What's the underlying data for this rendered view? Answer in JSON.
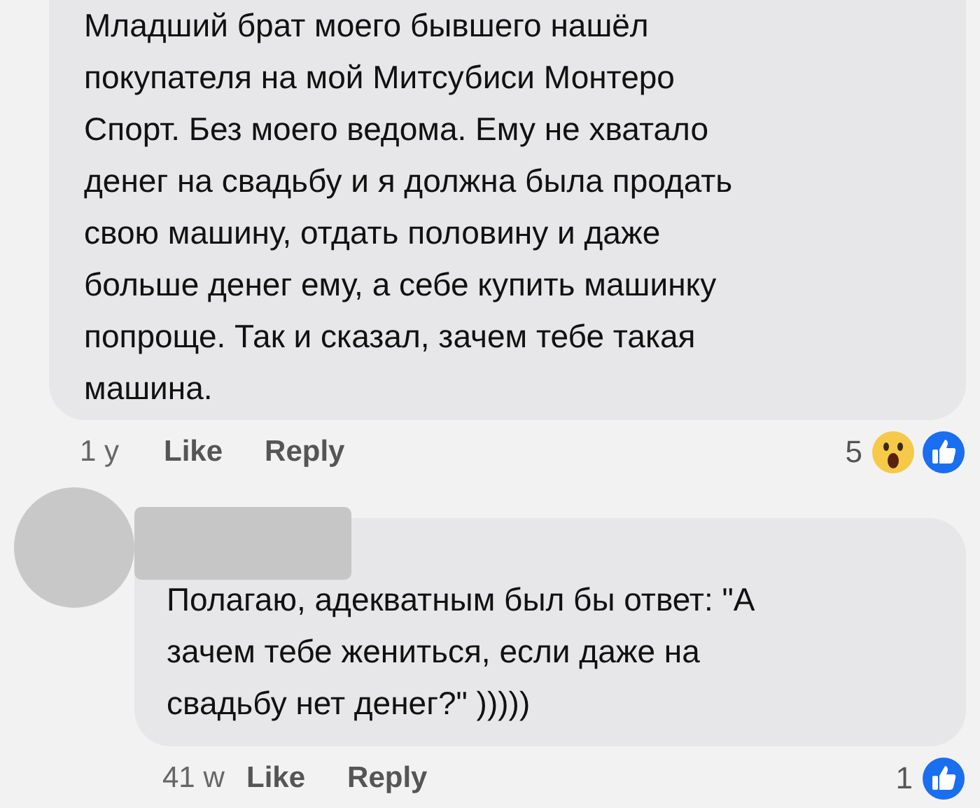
{
  "comments": [
    {
      "text_lines": [
        "Младший брат моего бывшего нашёл",
        "покупателя на мой Митсубиси Монтеро",
        "Спорт. Без моего ведома. Ему не хватало",
        "денег на свадьбу и я должна была продать",
        "свою машину, отдать половину и даже",
        "больше денег ему, а себе купить машинку",
        "попроще. Так и сказал, зачем тебе такая",
        "машина."
      ],
      "time": "1 y",
      "actions": [
        "Like",
        "Reply"
      ],
      "reaction_count": "5",
      "reactions": [
        {
          "kind": "wow"
        },
        {
          "kind": "like"
        }
      ]
    },
    {
      "author_redacted": true,
      "text_lines": [
        "Полагаю, адекватным был бы ответ: \"А",
        "зачем тебе жениться, если даже на",
        "свадьбу нет денег?\" )))))"
      ],
      "time": "41 w",
      "actions": [
        "Like",
        "Reply"
      ],
      "reaction_count": "1",
      "reactions": [
        {
          "kind": "like"
        }
      ]
    }
  ]
}
